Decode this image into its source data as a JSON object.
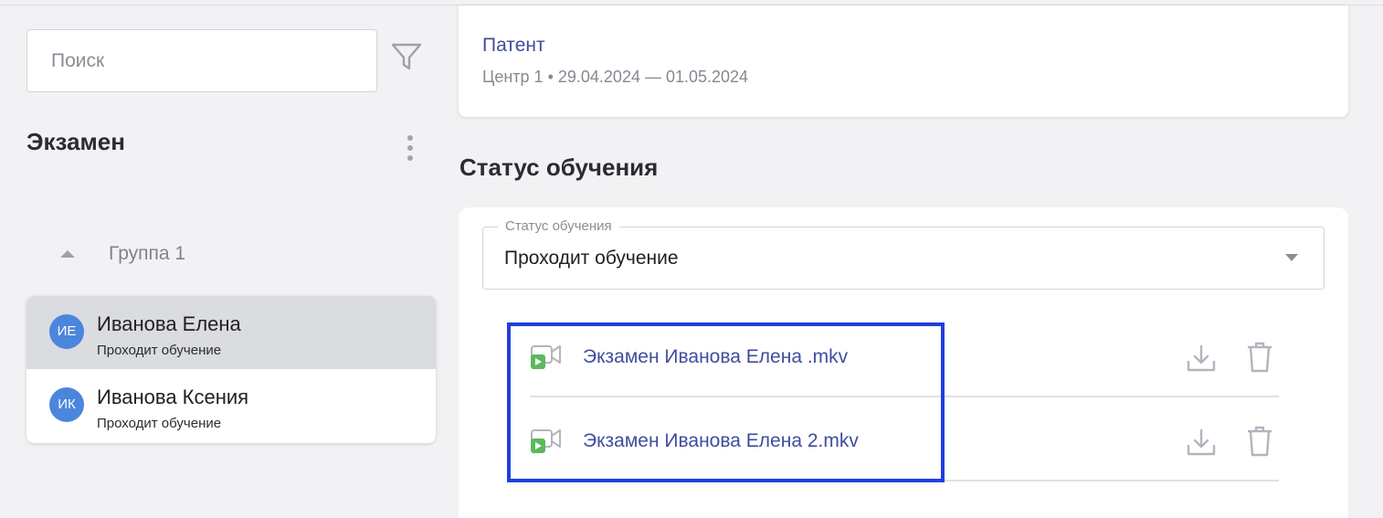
{
  "sidebar": {
    "search_placeholder": "Поиск",
    "exam_title": "Экзамен",
    "group_label": "Группа 1",
    "students": [
      {
        "initials": "ИЕ",
        "name": "Иванова Елена",
        "status": "Проходит обучение",
        "active": true
      },
      {
        "initials": "ИК",
        "name": "Иванова Ксения",
        "status": "Проходит обучение",
        "active": false
      }
    ]
  },
  "course": {
    "title": "Патент",
    "center": "Центр 1",
    "dates": "29.04.2024 — 01.05.2024"
  },
  "status_section": {
    "title": "Статус обучения",
    "select_label": "Статус обучения",
    "select_value": "Проходит обучение",
    "files": [
      {
        "name": "Экзамен Иванова Елена .mkv",
        "icon": "video-file-icon"
      },
      {
        "name": "Экзамен Иванова Елена 2.mkv",
        "icon": "video-file-icon"
      }
    ]
  },
  "colors": {
    "accent_link": "#3f4d9f",
    "avatar": "#4b86dd",
    "highlight": "#1f3fe0",
    "video_play": "#5cb85c"
  }
}
